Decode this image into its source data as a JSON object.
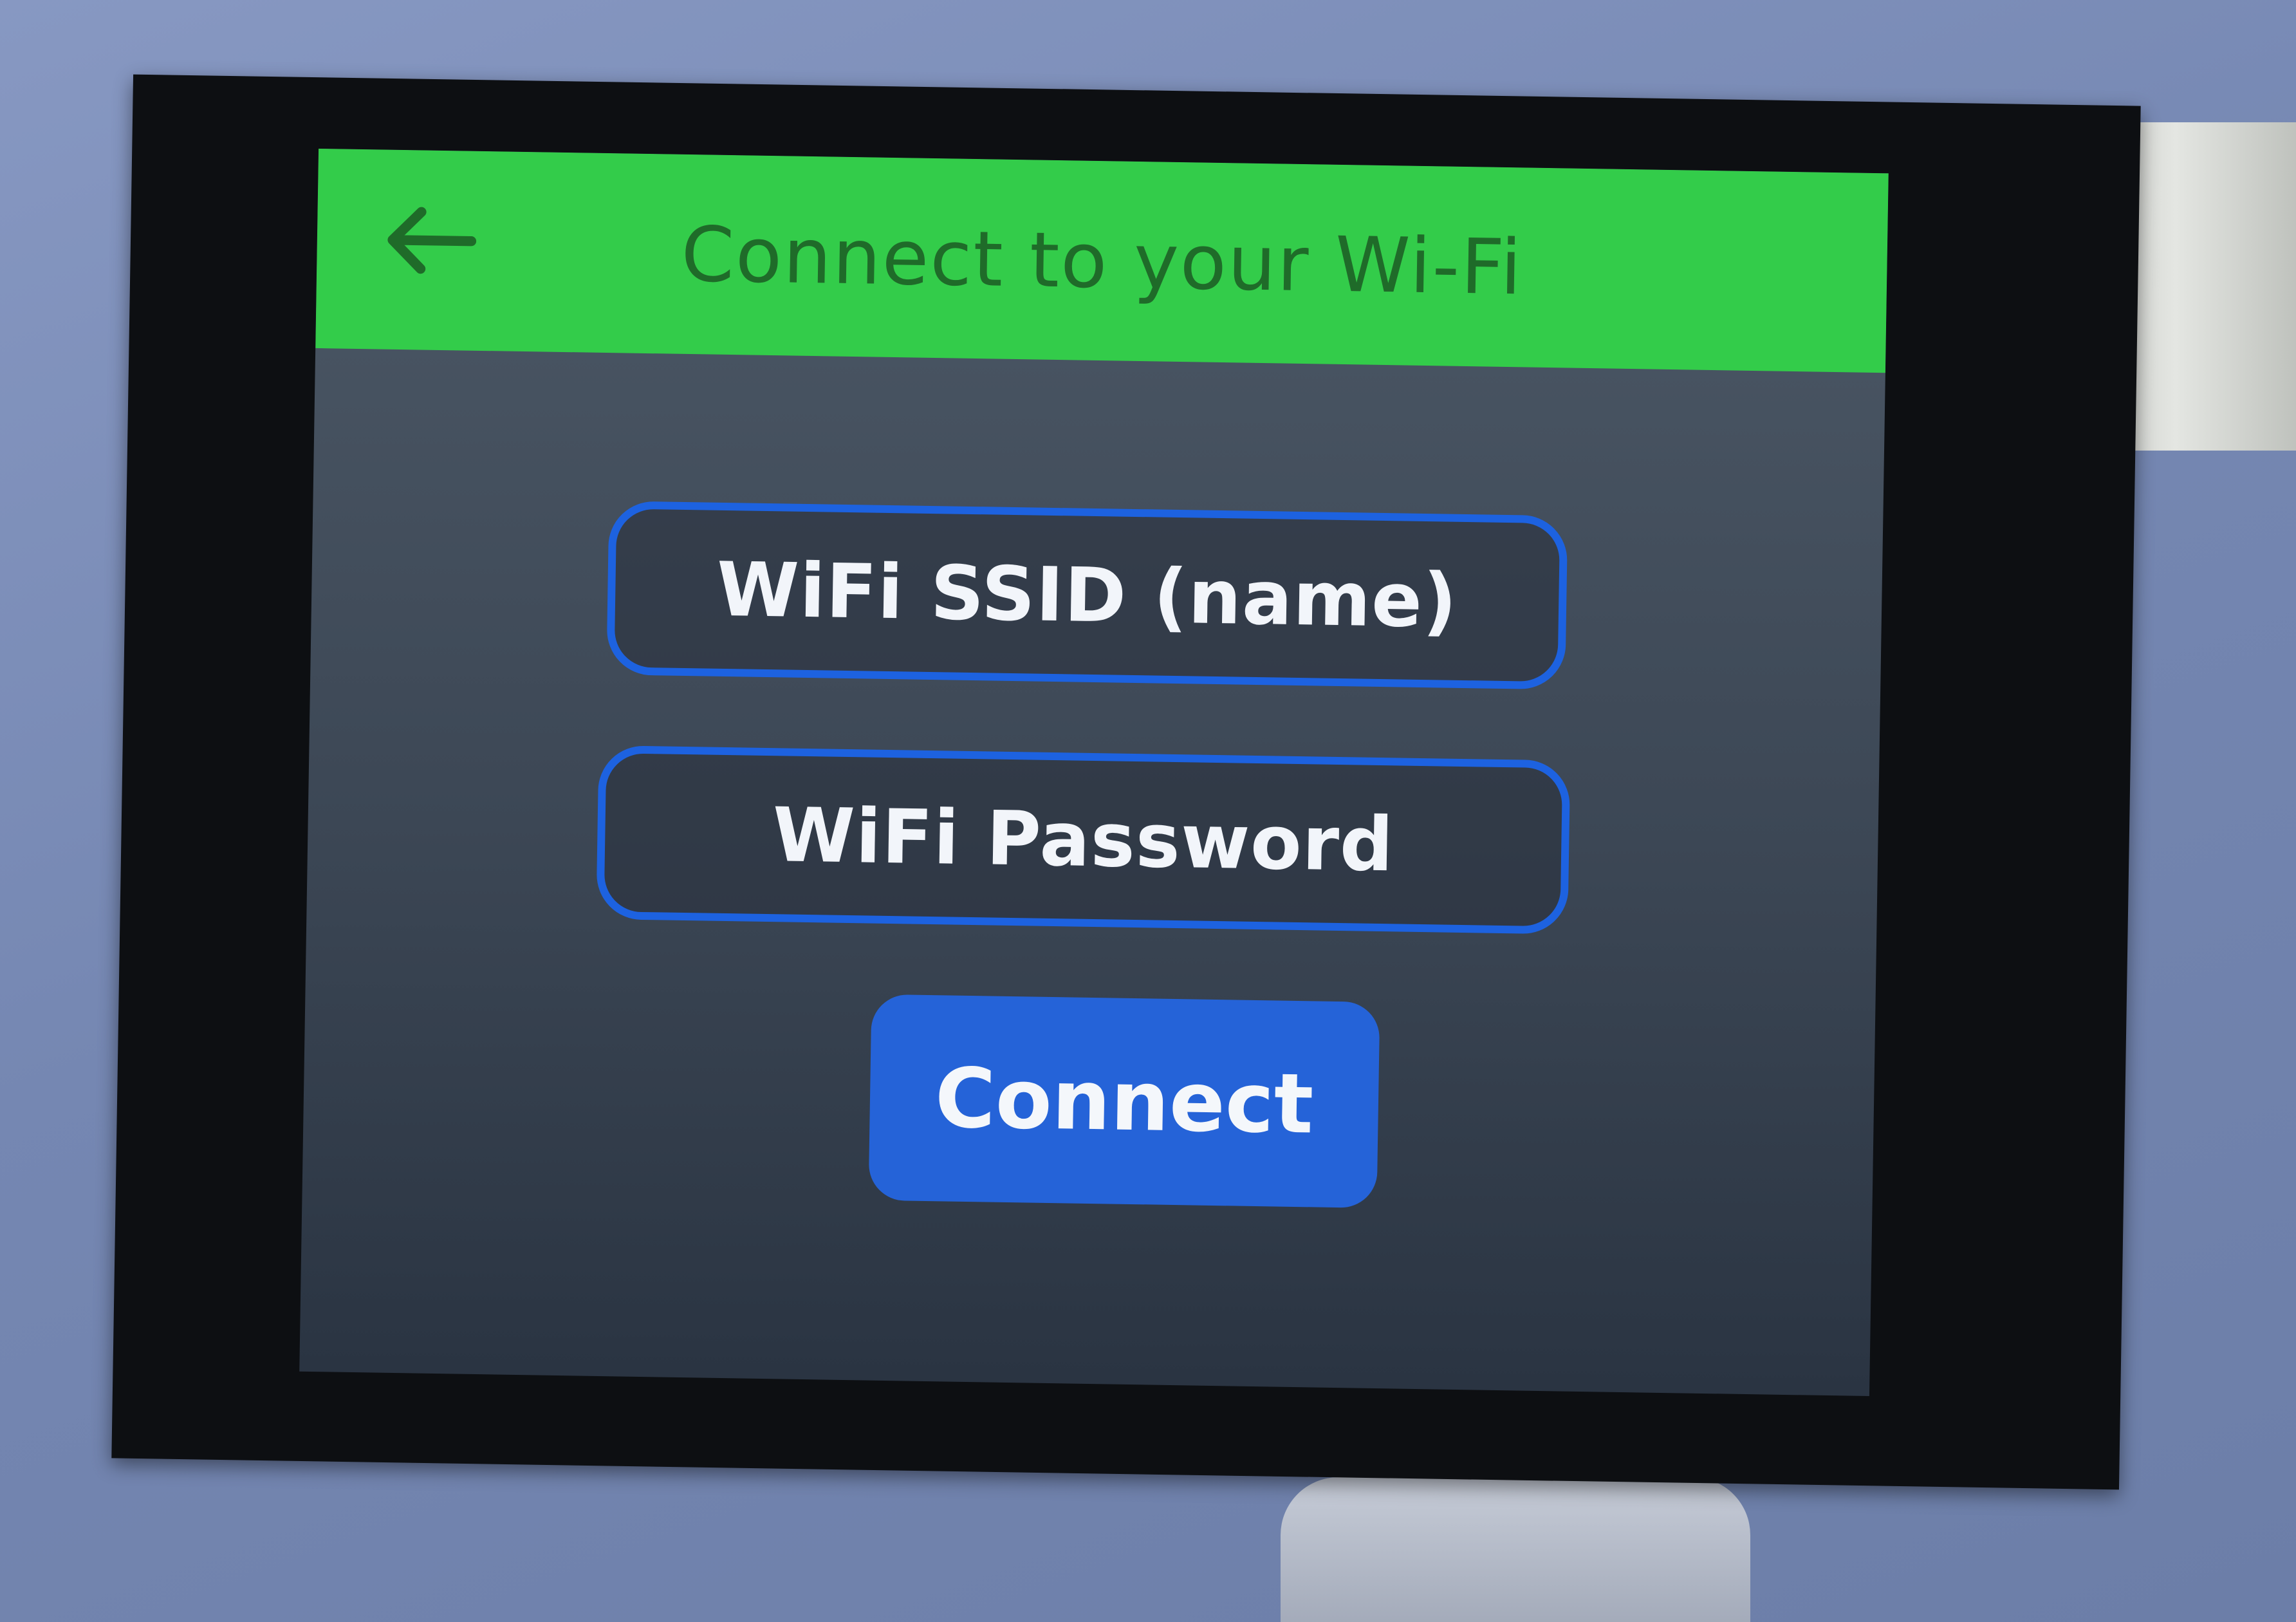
{
  "header": {
    "title": "Connect to your Wi-Fi",
    "back_icon": "arrow-left-icon",
    "background_color": "#33cc4a"
  },
  "form": {
    "ssid_placeholder": "WiFi SSID (name)",
    "password_placeholder": "WiFi Password",
    "field_border_color": "#1d62e0"
  },
  "actions": {
    "connect_label": "Connect",
    "connect_color": "#2563d8"
  }
}
